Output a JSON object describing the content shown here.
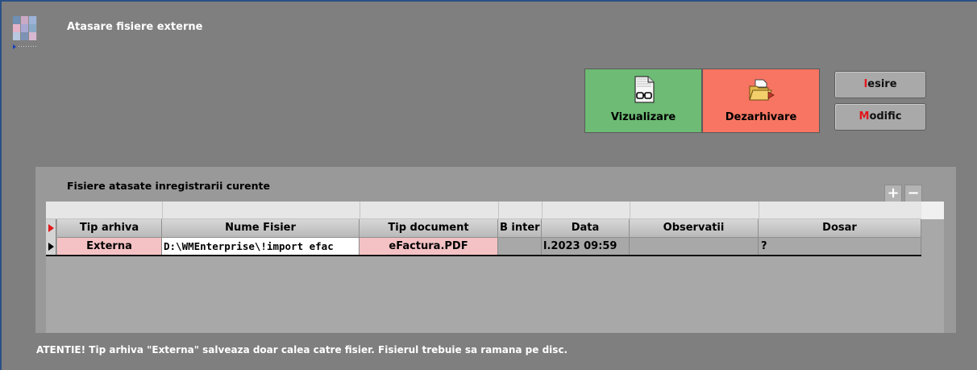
{
  "window": {
    "title": "Atasare fisiere externe"
  },
  "toolbar": {
    "view_label": "Vizualizare",
    "view_icon": "document-glasses-icon",
    "unarchive_label": "Dezarhivare",
    "unarchive_icon": "folder-extract-icon",
    "exit_hotkey": "I",
    "exit_rest": "esire",
    "modify_hotkey": "M",
    "modify_rest": "odific"
  },
  "panel": {
    "title": "Fisiere atasate inregistrarii curente",
    "add_icon": "plus-icon",
    "remove_icon": "minus-icon",
    "add_glyph": "+",
    "remove_glyph": "−"
  },
  "grid": {
    "columns": [
      "Tip arhiva",
      "Nume Fisier",
      "Tip document",
      "B inter",
      "Data",
      "Observatii",
      "Dosar"
    ],
    "rows": [
      {
        "tip_arhiva": "Externa",
        "nume_fisier": "D:\\WMEnterprise\\!import efac",
        "tip_document": "eFactura.PDF",
        "b_inter": "",
        "data": "l.2023 09:59",
        "observatii": "",
        "dosar": "?"
      }
    ]
  },
  "footer": {
    "note": "ATENTIE!   Tip arhiva \"Externa\" salveaza doar calea catre fisier. Fisierul trebuie sa ramana pe disc."
  },
  "colors": {
    "view_button": "#6dbb74",
    "unarchive_button": "#f77562",
    "pink_cell": "#f4c2c4",
    "background": "#7f7f7f"
  }
}
